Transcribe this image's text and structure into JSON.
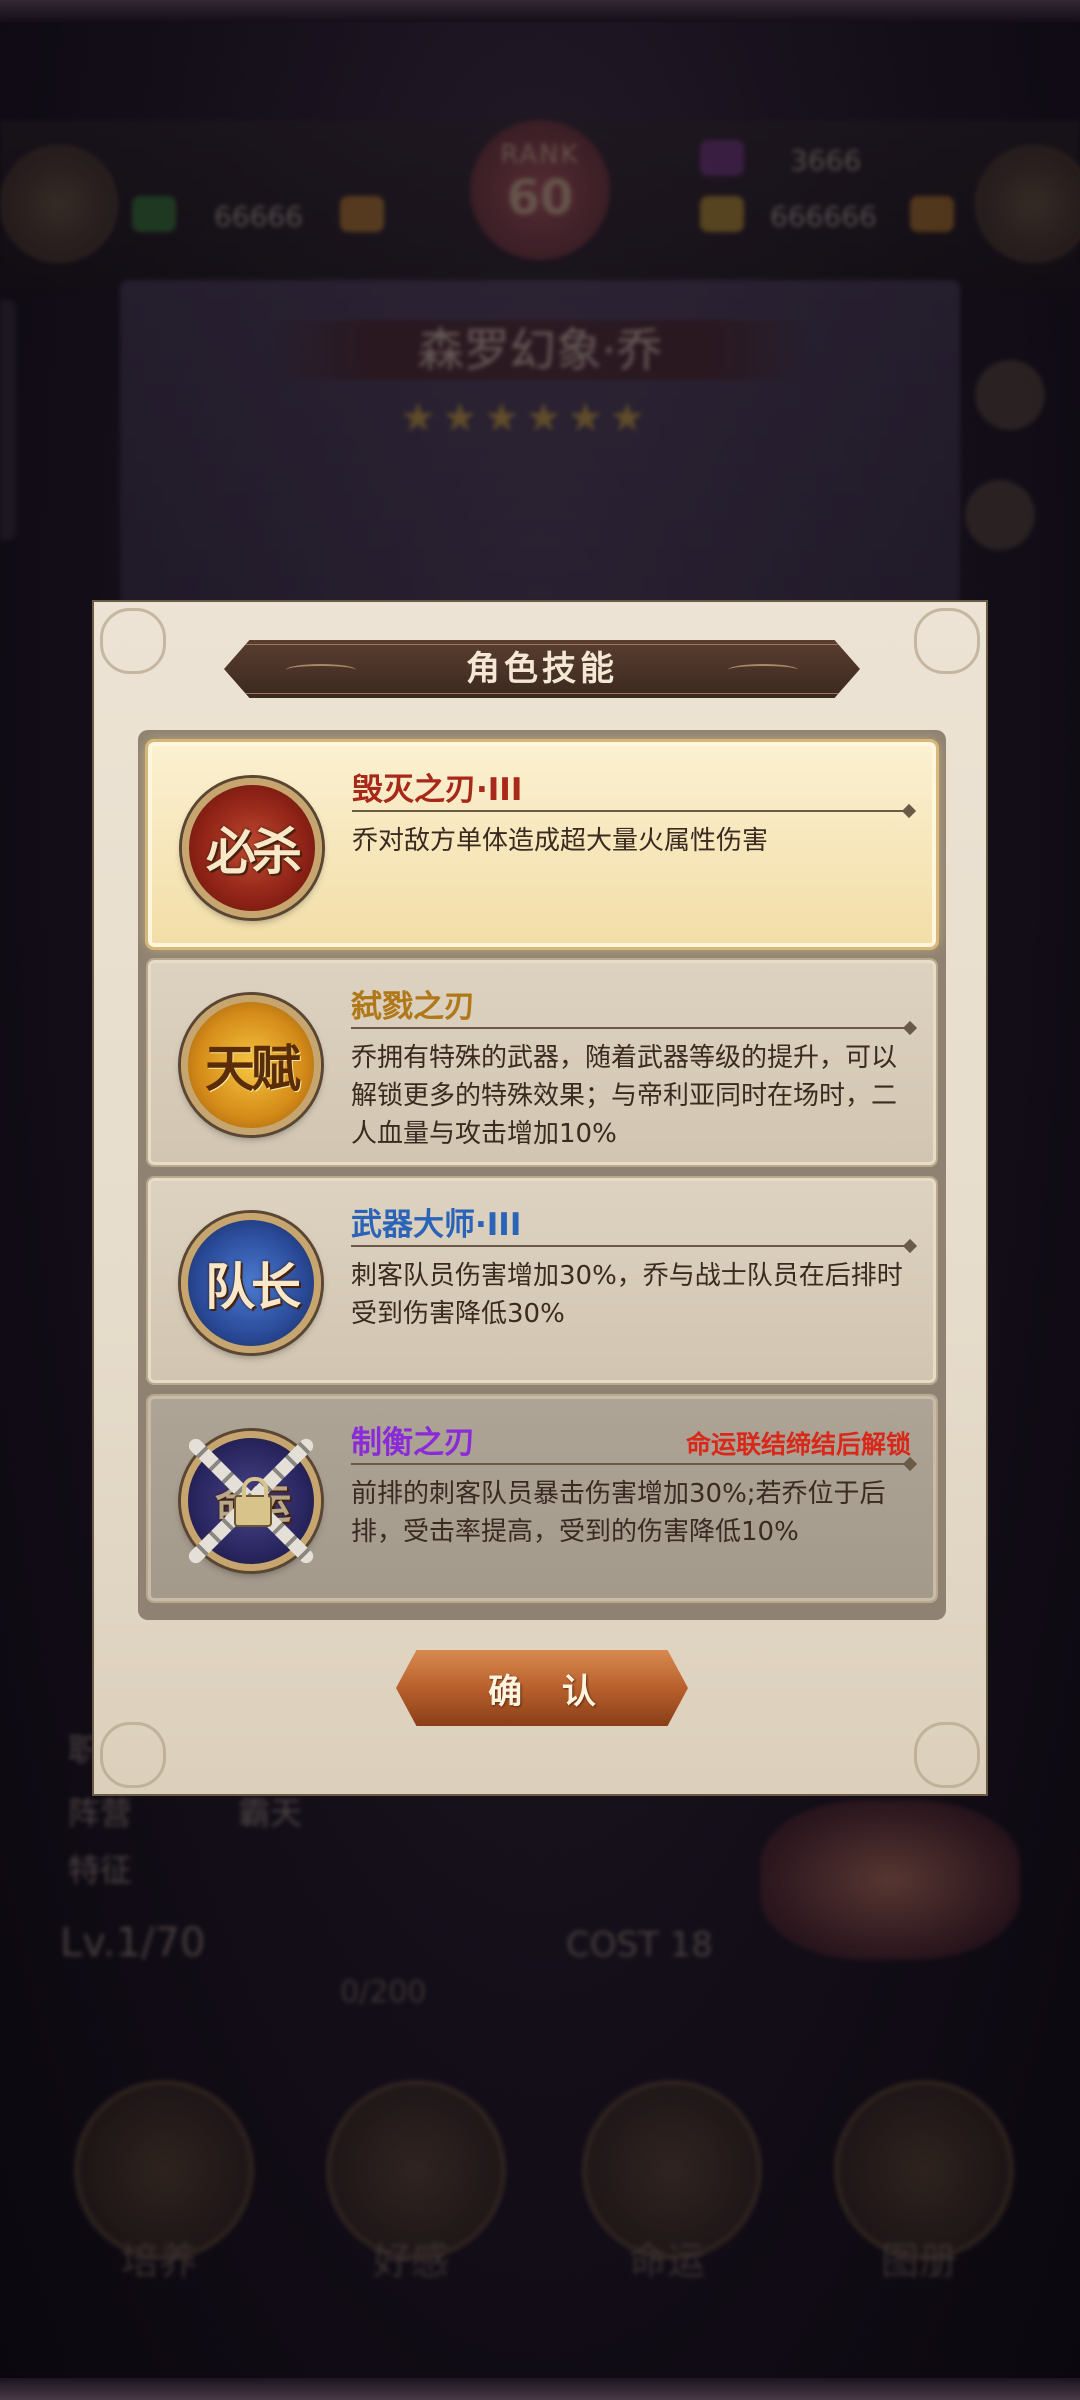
{
  "background": {
    "rank_label": "RANK",
    "rank_value": "60",
    "resource_1": "66666",
    "resource_2": "3666",
    "resource_3": "666666",
    "character_name": "森罗幻象·乔",
    "stars": "★★★★★★",
    "side_labels": [
      "职业",
      "阵营",
      "特征"
    ],
    "faction_value": "霸天",
    "level": "Lv.1/70",
    "cost": "COST 18",
    "exp": "0/200",
    "bottom_buttons": [
      "培养",
      "好感",
      "命运",
      "图册"
    ]
  },
  "modal": {
    "title": "角色技能",
    "confirm_label": "确 认",
    "skills": [
      {
        "icon_text": "必杀",
        "name": "毁灭之刃·III",
        "description": "乔对敌方单体造成超大量火属性伤害"
      },
      {
        "icon_text": "天赋",
        "name": "弑戮之刃",
        "description": "乔拥有特殊的武器，随着武器等级的提升，可以解锁更多的特殊效果；与帝利亚同时在场时，二人血量与攻击增加10%"
      },
      {
        "icon_text": "队长",
        "name": "武器大师·III",
        "description": "刺客队员伤害增加30%，乔与战士队员在后排时受到伤害降低30%"
      },
      {
        "icon_text": "命运",
        "name": "制衡之刃",
        "description": "前排的刺客队员暴击伤害增加30%;若乔位于后排，受击率提高，受到的伤害降低10%",
        "lock_message": "命运联结缔结后解锁"
      }
    ]
  },
  "colors": {
    "accent_red": "#a8281a",
    "accent_gold": "#b07818",
    "accent_blue": "#2a64b8",
    "accent_purple": "#8a2ad8",
    "lock_red": "#d8281a"
  }
}
